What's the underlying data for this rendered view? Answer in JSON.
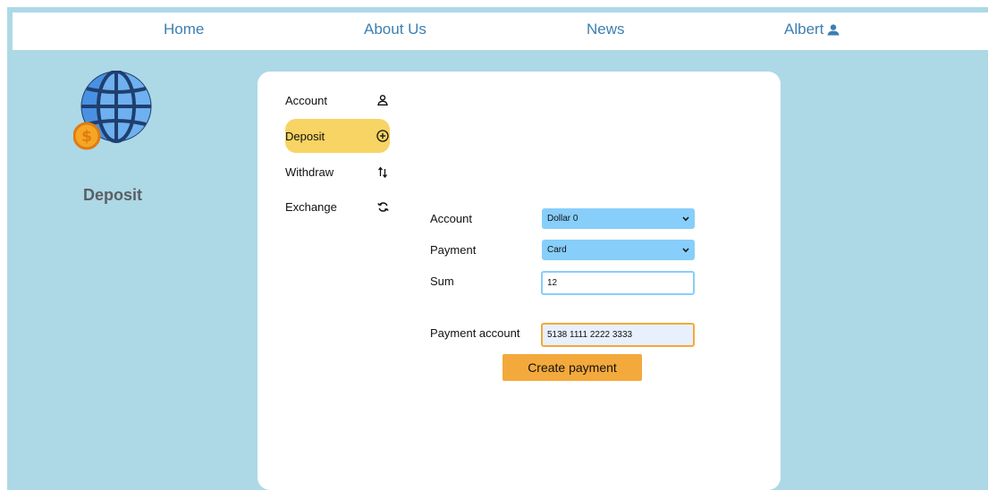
{
  "nav": {
    "home": "Home",
    "about": "About Us",
    "news": "News",
    "user": "Albert",
    "user_icon": "user-icon"
  },
  "sidebar": {
    "logo_icon": "globe-dollar-icon",
    "title": "Deposit"
  },
  "menu": {
    "items": [
      {
        "label": "Account",
        "icon": "user-outline-icon"
      },
      {
        "label": "Deposit",
        "icon": "plus-circle-icon",
        "active": true
      },
      {
        "label": "Withdraw",
        "icon": "arrows-up-down-icon"
      },
      {
        "label": "Exchange",
        "icon": "refresh-icon"
      }
    ]
  },
  "form": {
    "account_label": "Account",
    "account_value": "Dollar 0",
    "payment_label": "Payment",
    "payment_value": "Card",
    "sum_label": "Sum",
    "sum_value": "12",
    "payment_account_label": "Payment account",
    "payment_account_value": "5138 1111 2222 3333",
    "submit_label": "Create payment"
  },
  "colors": {
    "background": "#add8e6",
    "nav_link": "#3c7fb1",
    "menu_active": "#f7d463",
    "select": "#87cefa",
    "button": "#f4a93c"
  }
}
